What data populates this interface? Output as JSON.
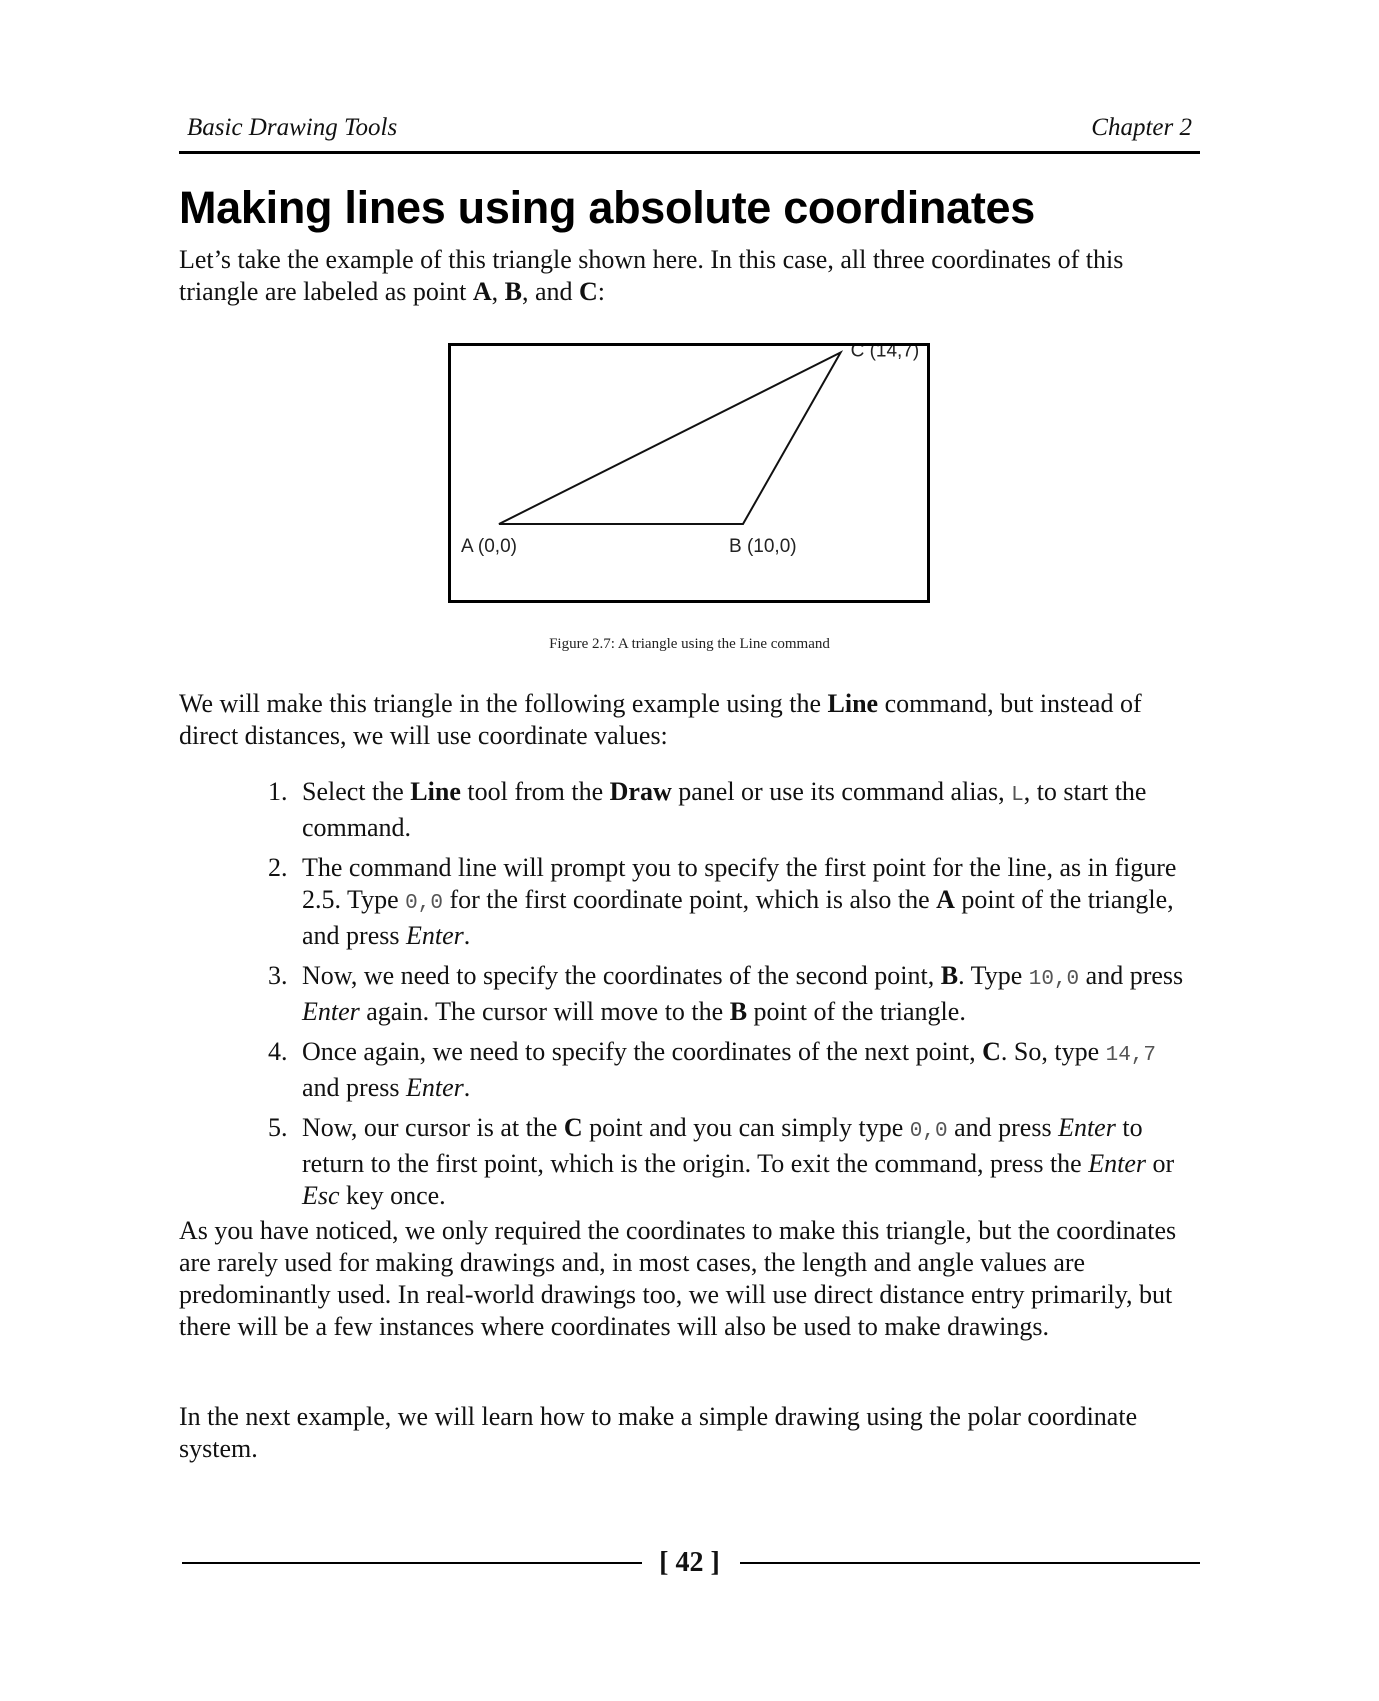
{
  "running_head": {
    "left": "Basic Drawing Tools",
    "right": "Chapter 2"
  },
  "title": "Making lines using absolute coordinates",
  "intro": {
    "text_1": "Let’s take the example of this triangle shown here. In this case, all three coordinates of this triangle are labeled as point ",
    "bold_a": "A",
    "sep_1": ", ",
    "bold_b": "B",
    "sep_2": ", and ",
    "bold_c": "C",
    "end": ":"
  },
  "figure": {
    "caption": "Figure 2.7: A triangle using the Line command",
    "points": [
      {
        "name": "A",
        "label": "A (0,0)",
        "x": 0,
        "y": 0
      },
      {
        "name": "B",
        "label": "B (10,0)",
        "x": 10,
        "y": 0
      },
      {
        "name": "C",
        "label": "C (14,7)",
        "x": 14,
        "y": 7
      }
    ]
  },
  "para_2": {
    "text_1": "We will make this triangle in the following example using the ",
    "bold": "Line",
    "text_2": " command, but instead of direct distances, we will use coordinate values:"
  },
  "steps": [
    {
      "num": "1.",
      "parts": [
        {
          "t": "Select the "
        },
        {
          "b": "Line"
        },
        {
          "t": " tool from the "
        },
        {
          "b": "Draw"
        },
        {
          "t": " panel or use its command alias, "
        },
        {
          "m": "L"
        },
        {
          "t": ", to start the command."
        }
      ]
    },
    {
      "num": "2.",
      "parts": [
        {
          "t": "The command line will prompt you to specify the first point for the line, as in figure 2.5. Type "
        },
        {
          "m": "0,0"
        },
        {
          "t": " for the first coordinate point, which is also the "
        },
        {
          "b": "A"
        },
        {
          "t": " point of the triangle, and press "
        },
        {
          "i": "Enter"
        },
        {
          "t": "."
        }
      ]
    },
    {
      "num": "3.",
      "parts": [
        {
          "t": "Now, we need to specify the coordinates of the second point, "
        },
        {
          "b": "B"
        },
        {
          "t": ". Type "
        },
        {
          "m": "10,0"
        },
        {
          "t": " and press "
        },
        {
          "i": "Enter"
        },
        {
          "t": " again. The cursor will move to the "
        },
        {
          "b": "B"
        },
        {
          "t": " point of the triangle."
        }
      ]
    },
    {
      "num": "4.",
      "parts": [
        {
          "t": "Once again, we need to specify the coordinates of the next point, "
        },
        {
          "b": "C"
        },
        {
          "t": ". So, type "
        },
        {
          "m": "14,7"
        },
        {
          "t": " and press "
        },
        {
          "i": "Enter"
        },
        {
          "t": "."
        }
      ]
    },
    {
      "num": "5.",
      "parts": [
        {
          "t": "Now, our cursor is at the "
        },
        {
          "b": "C"
        },
        {
          "t": " point and you can simply type "
        },
        {
          "m": "0,0"
        },
        {
          "t": " and press "
        },
        {
          "i": "Enter"
        },
        {
          "t": " to return to the first point, which is the origin. To exit the command, press the "
        },
        {
          "i": "Enter"
        },
        {
          "t": " or "
        },
        {
          "i": "Esc"
        },
        {
          "t": " key once."
        }
      ]
    }
  ],
  "para_3": "As you have noticed, we only required the coordinates to make this triangle, but the coordinates are rarely used for making drawings and, in most cases, the length and angle values are predominantly used. In real-world drawings too, we will use direct distance entry primarily, but there will be a few instances where coordinates will also be used to make drawings.",
  "para_4": "In the next example, we will learn how to make a simple drawing using the polar coordinate system.",
  "page_number": "[ 42 ]"
}
